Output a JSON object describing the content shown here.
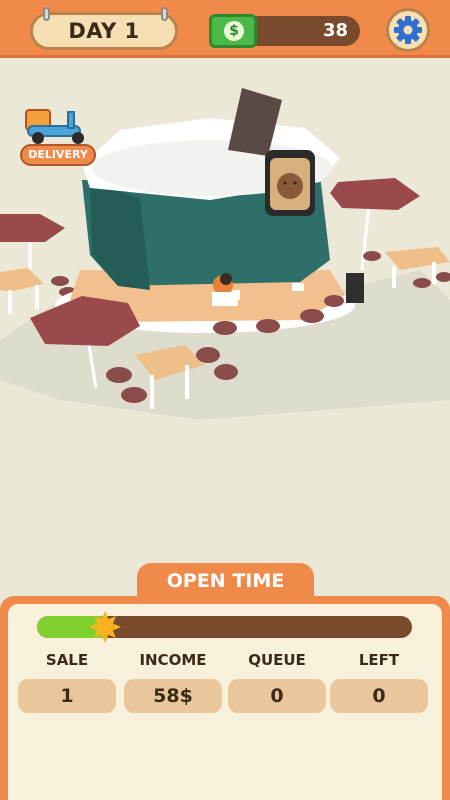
{
  "header": {
    "day_label": "DAY 1",
    "money": "38",
    "money_icon": "dollar-bill-icon",
    "settings_icon": "gear-icon"
  },
  "delivery": {
    "label": "DELIVERY",
    "icon": "delivery-scooter-icon"
  },
  "panel": {
    "title": "OPEN TIME",
    "progress": 0.18,
    "colors": {
      "accent": "#f08a4b",
      "bar_track": "#7a4a2e",
      "bar_fill": "#7ed12f"
    },
    "stats": [
      {
        "label": "SALE",
        "value": "1"
      },
      {
        "label": "INCOME",
        "value": "58$"
      },
      {
        "label": "QUEUE",
        "value": "0"
      },
      {
        "label": "LEFT",
        "value": "0"
      }
    ]
  }
}
